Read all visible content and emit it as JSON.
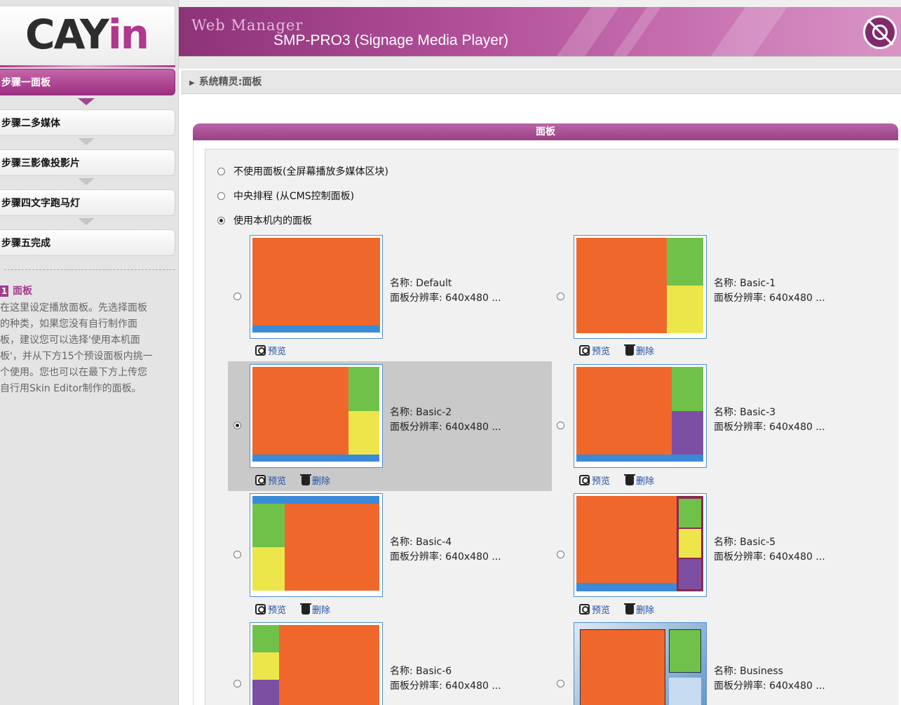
{
  "logo": {
    "text_main": "CAY",
    "text_accent": "in"
  },
  "header": {
    "title": "Web Manager",
    "subtitle": "SMP-PRO3 (Signage Media Player)"
  },
  "breadcrumb": "系统精灵:面板",
  "steps": [
    {
      "label": "步骤一面板",
      "active": true
    },
    {
      "label": "步骤二多媒体",
      "active": false
    },
    {
      "label": "步骤三影像投影片",
      "active": false
    },
    {
      "label": "步骤四文字跑马灯",
      "active": false
    },
    {
      "label": "步骤五完成",
      "active": false
    }
  ],
  "help": {
    "number": "1",
    "title": "面板",
    "lines": [
      "在这里设定播放面板。先选择面板",
      "的种类，如果您没有自行制作面",
      "板，建议您可以选择'使用本机面",
      "板'，并从下方15个预设面板内挑一",
      "个使用。您也可以在最下方上传您",
      "自行用Skin Editor制作的面板。"
    ]
  },
  "panel": {
    "title": "面板",
    "modes": [
      {
        "label": "不使用面板(全屏幕播放多媒体区块)",
        "selected": false
      },
      {
        "label": "中央排程 (从CMS控制面板)",
        "selected": false
      },
      {
        "label": "使用本机内的面板",
        "selected": true
      }
    ],
    "actions": {
      "preview": "预览",
      "delete": "删除"
    },
    "skins": [
      {
        "name": "名称: Default",
        "resolution": "面板分辨率: 640x480 ...",
        "selected": false,
        "deletable": false
      },
      {
        "name": "名称: Basic-1",
        "resolution": "面板分辨率: 640x480 ...",
        "selected": false,
        "deletable": true
      },
      {
        "name": "名称: Basic-2",
        "resolution": "面板分辨率: 640x480 ...",
        "selected": true,
        "deletable": true
      },
      {
        "name": "名称: Basic-3",
        "resolution": "面板分辨率: 640x480 ...",
        "selected": false,
        "deletable": true
      },
      {
        "name": "名称: Basic-4",
        "resolution": "面板分辨率: 640x480 ...",
        "selected": false,
        "deletable": true
      },
      {
        "name": "名称: Basic-5",
        "resolution": "面板分辨率: 640x480 ...",
        "selected": false,
        "deletable": true
      },
      {
        "name": "名称: Basic-6",
        "resolution": "面板分辨率: 640x480 ...",
        "selected": false,
        "deletable": true
      },
      {
        "name": "名称: Business",
        "resolution": "面板分辨率: 640x480 ...",
        "selected": false,
        "deletable": true
      }
    ]
  },
  "colors": {
    "accent": "#a23c8d",
    "media_area": "#f0672b",
    "ticker_area": "#3b8ad8",
    "green_area": "#6fc14a",
    "yellow_area": "#ede64a",
    "purple_area": "#7c4fa2"
  }
}
